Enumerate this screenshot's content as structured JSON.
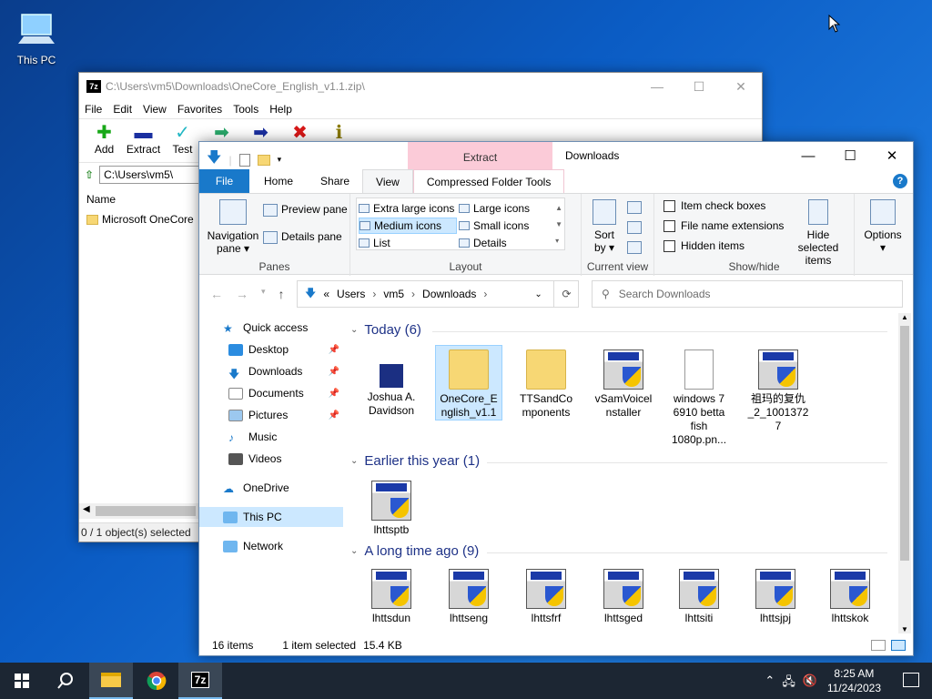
{
  "desktop": {
    "this_pc_label": "This PC"
  },
  "sevenzip": {
    "title": "C:\\Users\\vm5\\Downloads\\OneCore_English_v1.1.zip\\",
    "logo": "7z",
    "menu": [
      "File",
      "Edit",
      "View",
      "Favorites",
      "Tools",
      "Help"
    ],
    "tools": [
      {
        "label": "Add",
        "icon": "add-icon",
        "glyph": "✚",
        "color": "#18a818"
      },
      {
        "label": "Extract",
        "icon": "extract-icon",
        "glyph": "▬",
        "color": "#1a2fa0"
      },
      {
        "label": "Test",
        "icon": "test-icon",
        "glyph": "✓",
        "color": "#22b7c4"
      },
      {
        "label": "",
        "icon": "copy-icon",
        "glyph": "➡",
        "color": "#2aa86a"
      },
      {
        "label": "",
        "icon": "move-icon",
        "glyph": "➡",
        "color": "#1a2fa0"
      },
      {
        "label": "",
        "icon": "delete-icon",
        "glyph": "✖",
        "color": "#d81818"
      },
      {
        "label": "",
        "icon": "info-icon",
        "glyph": "ℹ",
        "color": "#8a7a00"
      }
    ],
    "address": "C:\\Users\\vm5\\",
    "column_name": "Name",
    "item": "Microsoft OneCore",
    "status": "0 / 1 object(s) selected"
  },
  "explorer": {
    "extract_context": "Extract",
    "window_title": "Downloads",
    "tabs": {
      "file": "File",
      "home": "Home",
      "share": "Share",
      "view": "View",
      "compressed": "Compressed Folder Tools"
    },
    "panes": {
      "navigation": "Navigation",
      "navigation2": "pane ▾",
      "preview": "Preview pane",
      "details": "Details pane",
      "group": "Panes"
    },
    "layout": {
      "xl": "Extra large icons",
      "large": "Large icons",
      "medium": "Medium icons",
      "small": "Small icons",
      "list": "List",
      "details": "Details",
      "group": "Layout"
    },
    "current_view": {
      "sort": "Sort",
      "sort2": "by ▾",
      "group": "Current view"
    },
    "showhide": {
      "item_check": "Item check boxes",
      "file_ext": "File name extensions",
      "hidden": "Hidden items",
      "hide_sel1": "Hide selected",
      "hide_sel2": "items",
      "group": "Show/hide"
    },
    "options": {
      "label": "Options",
      "arrow": "▾"
    },
    "breadcrumb": [
      "«",
      "Users",
      "vm5",
      "Downloads"
    ],
    "search_placeholder": "Search Downloads",
    "nav": {
      "quick_access": "Quick access",
      "desktop": "Desktop",
      "downloads": "Downloads",
      "documents": "Documents",
      "pictures": "Pictures",
      "music": "Music",
      "videos": "Videos",
      "onedrive": "OneDrive",
      "thispc": "This PC",
      "network": "Network"
    },
    "groups": {
      "today": "Today (6)",
      "earlier": "Earlier this year (1)",
      "longago": "A long time ago (9)"
    },
    "today_items": [
      "Joshua A. Davidson",
      "OneCore_English_v1.1",
      "TTSandComponents",
      "vSamVoiceInstaller",
      "windows 7 6910 betta fish 1080p.pn...",
      "祖玛的复仇_2_10013727"
    ],
    "today_lines": [
      [
        "Joshua A.",
        "Davidson"
      ],
      [
        "OneCore_E",
        "nglish_v1.1"
      ],
      [
        "TTSandCo",
        "mponents"
      ],
      [
        "vSamVoicel",
        "nstaller"
      ],
      [
        "windows 7",
        "6910 betta",
        "fish",
        "1080p.pn..."
      ],
      [
        "祖玛的复仇",
        "_2_1001372",
        "7"
      ]
    ],
    "earlier_items": [
      "lhttsptb"
    ],
    "longago_items": [
      "lhttsdun",
      "lhttseng",
      "lhttsfrf",
      "lhttsged",
      "lhttsiti",
      "lhttsjpj",
      "lhttskok"
    ],
    "status": {
      "count": "16 items",
      "selected": "1 item selected",
      "size": "15.4 KB"
    }
  },
  "taskbar": {
    "time": "8:25 AM",
    "date": "11/24/2023"
  }
}
